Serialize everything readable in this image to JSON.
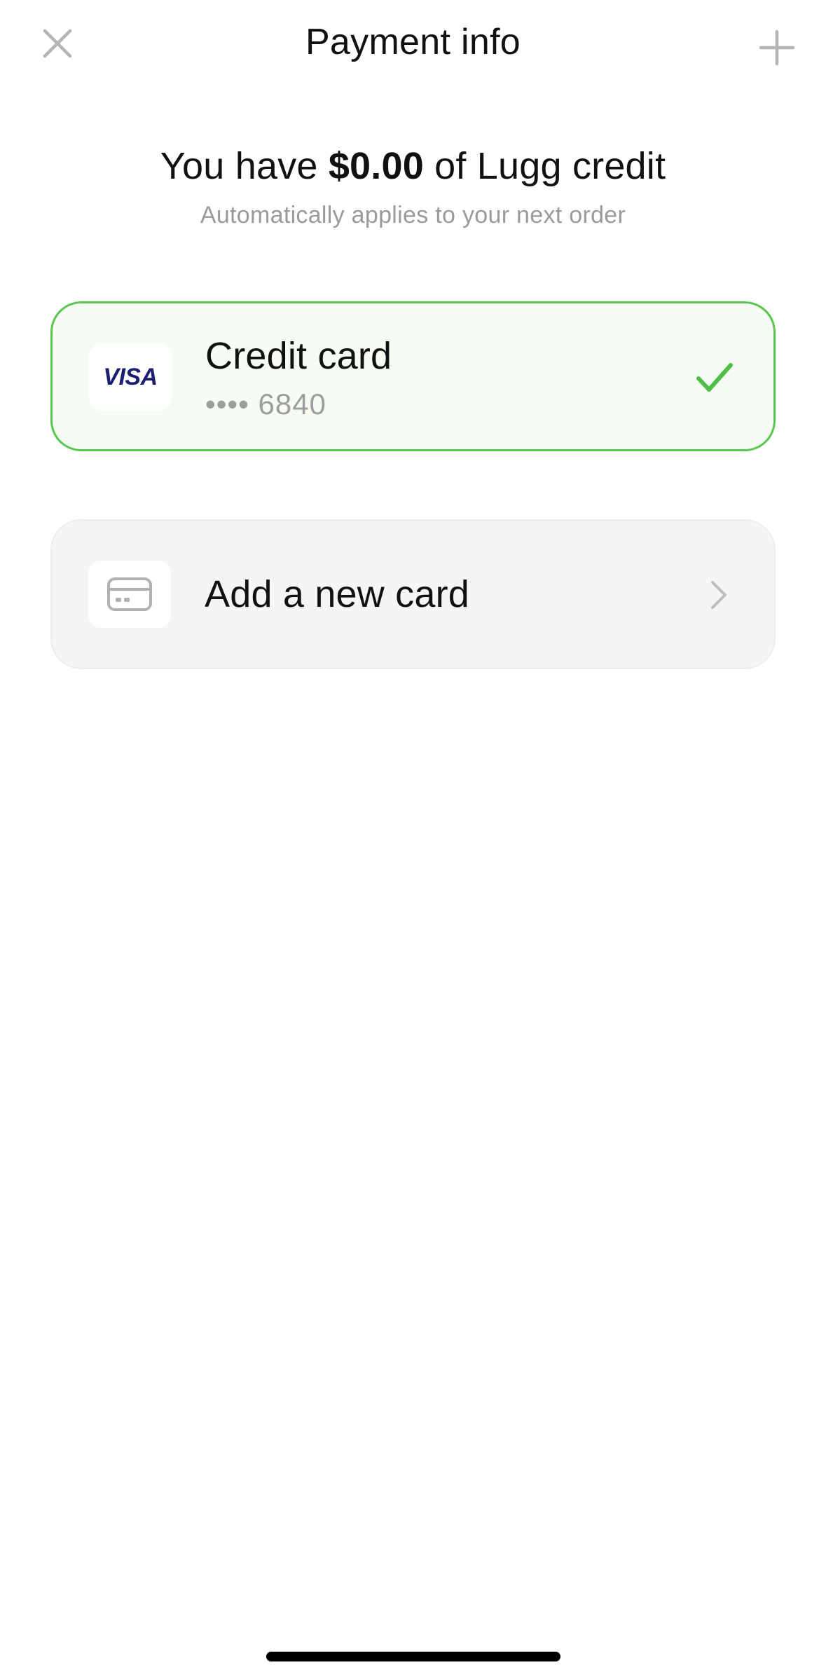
{
  "header": {
    "title": "Payment info",
    "close_icon": "close-icon",
    "add_icon": "plus-icon"
  },
  "credit": {
    "prefix": "You have ",
    "amount": "$0.00",
    "suffix": " of Lugg credit",
    "subtitle": "Automatically applies to your next order"
  },
  "payment_methods": [
    {
      "brand": "VISA",
      "title": "Credit card",
      "masked_number": "•••• 6840",
      "selected": true,
      "status_icon": "checkmark-icon"
    }
  ],
  "add_card": {
    "label": "Add a new card",
    "icon": "credit-card-icon",
    "trailing_icon": "chevron-right-icon"
  },
  "colors": {
    "selected_border": "#58c64f",
    "selected_background": "#f6fbf4",
    "add_card_background": "#f5f5f7",
    "visa_blue": "#1a1f71",
    "secondary_text": "#9a9a9e"
  }
}
